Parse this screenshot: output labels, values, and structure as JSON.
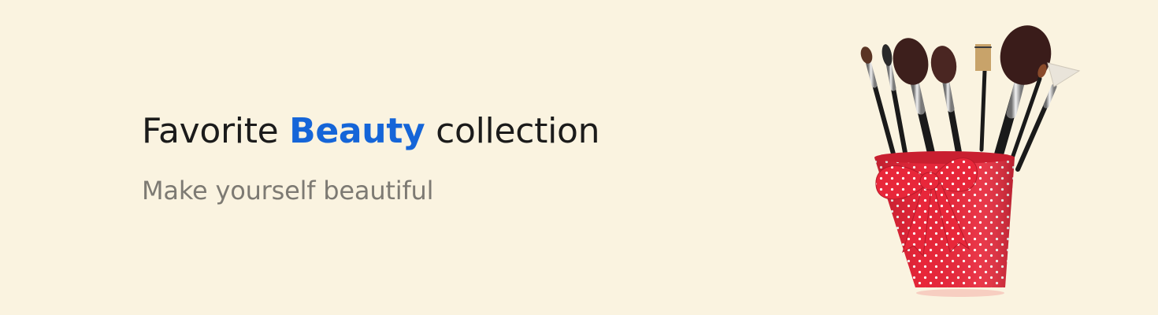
{
  "banner": {
    "title_before": "Favorite ",
    "title_highlight": "Beauty",
    "title_after": " collection",
    "subtitle": "Make yourself beautiful"
  },
  "colors": {
    "background": "#faf3e0",
    "title": "#1b1b1b",
    "highlight": "#1565d8",
    "subtitle": "#7d7a73",
    "cup": "#e8273a"
  },
  "image": {
    "subject": "makeup-brushes-in-red-polka-dot-cup"
  }
}
